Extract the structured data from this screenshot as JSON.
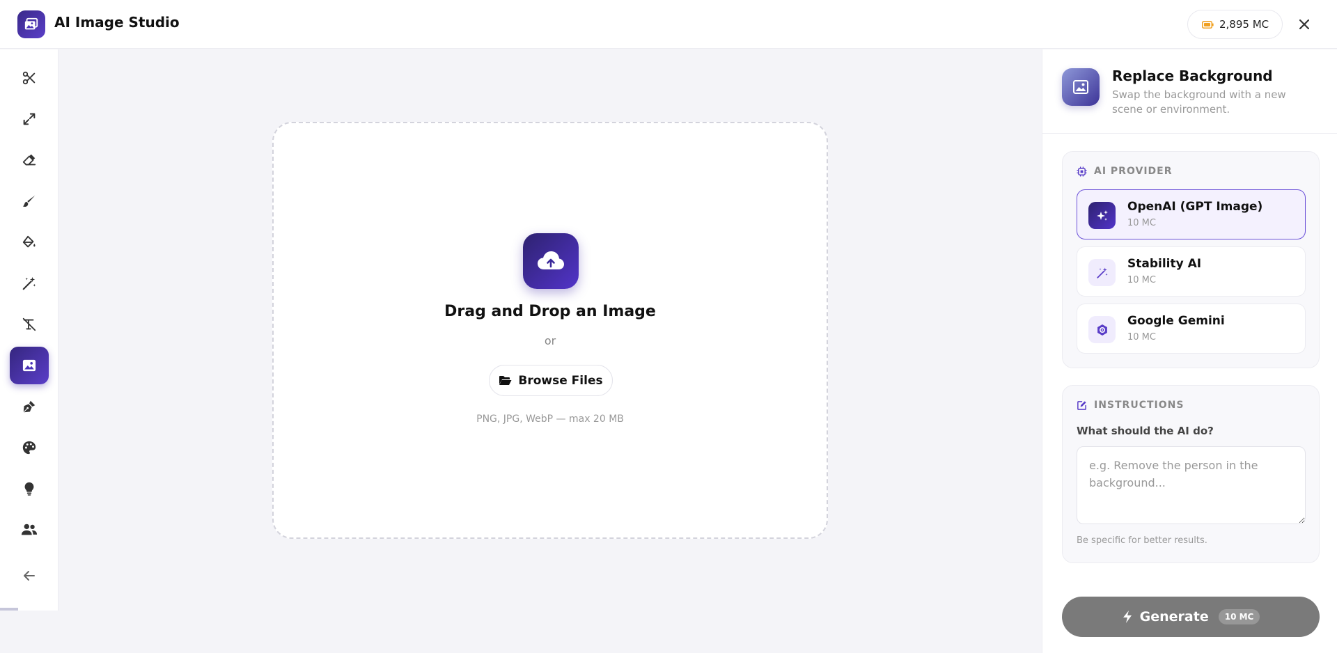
{
  "app": {
    "title": "AI Image Studio",
    "logo_icon": "image-icon",
    "credits": "2,895 MC",
    "credits_icon": "battery-icon",
    "close_icon": "close-icon"
  },
  "sidebar": {
    "items": [
      {
        "icon": "scissors-icon",
        "active": false
      },
      {
        "icon": "expand-icon",
        "active": false
      },
      {
        "icon": "eraser-icon",
        "active": false
      },
      {
        "icon": "brush-icon",
        "active": false
      },
      {
        "icon": "paint-bucket-icon",
        "active": false
      },
      {
        "icon": "magic-wand-icon",
        "active": false
      },
      {
        "icon": "remove-text-icon",
        "active": false
      },
      {
        "icon": "image-icon",
        "active": true
      },
      {
        "icon": "pen-nib-icon",
        "active": false
      },
      {
        "icon": "palette-icon",
        "active": false
      },
      {
        "icon": "lightbulb-icon",
        "active": false
      },
      {
        "icon": "users-icon",
        "active": false
      }
    ],
    "collapse_icon": "arrow-left-icon"
  },
  "upload": {
    "icon": "cloud-upload-icon",
    "title": "Drag and Drop an Image",
    "or": "or",
    "browse_label": "Browse Files",
    "browse_icon": "folder-open-icon",
    "hint": "PNG, JPG, WebP — max 20 MB"
  },
  "tool": {
    "icon": "image-icon",
    "title": "Replace Background",
    "description": "Swap the background with a new scene or environment."
  },
  "provider": {
    "heading": "AI PROVIDER",
    "heading_icon": "chip-icon",
    "options": [
      {
        "name": "OpenAI (GPT Image)",
        "cost": "10 MC",
        "icon": "sparkles-icon",
        "selected": true
      },
      {
        "name": "Stability AI",
        "cost": "10 MC",
        "icon": "magic-wand-icon",
        "selected": false
      },
      {
        "name": "Google Gemini",
        "cost": "10 MC",
        "icon": "gemini-icon",
        "selected": false
      }
    ]
  },
  "instructions": {
    "heading": "INSTRUCTIONS",
    "heading_icon": "edit-icon",
    "label": "What should the AI do?",
    "placeholder": "e.g. Remove the person in the background...",
    "value": "",
    "hint": "Be specific for better results."
  },
  "generate": {
    "label": "Generate",
    "icon": "bolt-icon",
    "cost": "10 MC"
  },
  "colors": {
    "accent": "#4a33b8",
    "generate_disabled": "#7a7a7a",
    "background": "#f4f4f8"
  }
}
